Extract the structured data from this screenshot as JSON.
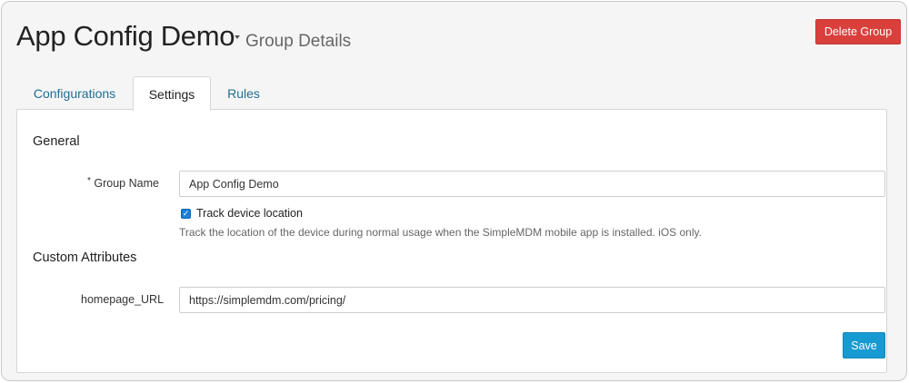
{
  "header": {
    "title": "App Config Demo",
    "subtitle": "Group Details",
    "delete_label": "Delete Group"
  },
  "tabs": [
    {
      "label": "Configurations",
      "active": false
    },
    {
      "label": "Settings",
      "active": true
    },
    {
      "label": "Rules",
      "active": false
    }
  ],
  "general": {
    "section_title": "General",
    "group_name_label": "Group Name",
    "required_marker": "*",
    "group_name_value": "App Config Demo",
    "track_location_label": "Track device location",
    "track_location_checked": true,
    "track_location_help": "Track the location of the device during normal usage when the SimpleMDM mobile app is installed. iOS only."
  },
  "custom_attributes": {
    "section_title": "Custom Attributes",
    "attributes": [
      {
        "label": "homepage_URL",
        "value": "https://simplemdm.com/pricing/"
      }
    ]
  },
  "actions": {
    "save_label": "Save"
  },
  "colors": {
    "delete": "#d9403c",
    "save": "#179ad1",
    "link": "#1f6e94",
    "checkbox": "#1d7fd6"
  },
  "icons": {
    "title_dropdown": "caret-down-icon",
    "checkbox": "check-icon"
  }
}
